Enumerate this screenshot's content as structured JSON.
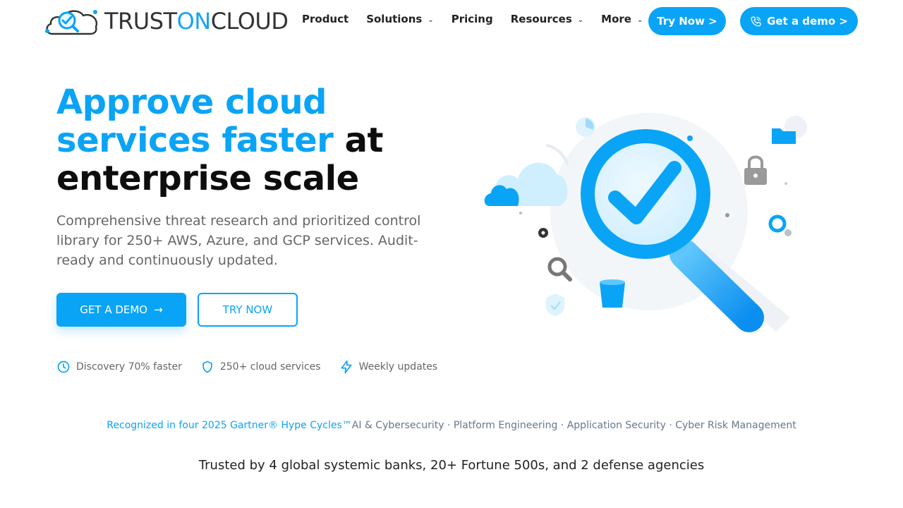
{
  "brand": {
    "name_part1": "TRUST",
    "name_part2": "ON",
    "name_part3": "CLOUD",
    "accent": "#0aa4f6"
  },
  "nav": {
    "items": [
      {
        "label": "Product",
        "has_dropdown": false
      },
      {
        "label": "Solutions",
        "has_dropdown": true
      },
      {
        "label": "Pricing",
        "has_dropdown": false
      },
      {
        "label": "Resources",
        "has_dropdown": true
      },
      {
        "label": "More",
        "has_dropdown": true
      }
    ],
    "try_label": "Try Now >",
    "demo_label": "Get a demo >",
    "demo_icon": "phone-icon"
  },
  "hero": {
    "title_blue": "Approve cloud services faster",
    "title_dark": "at enterprise scale",
    "subtitle": "Comprehensive threat research and prioritized control library for 250+ AWS, Azure, and GCP services. Audit-ready and continuously updated.",
    "cta_primary": "GET A DEMO",
    "cta_primary_icon": "arrow-right-icon",
    "cta_secondary": "TRY NOW",
    "features": [
      {
        "icon": "clock-icon",
        "label": "Discovery 70% faster"
      },
      {
        "icon": "shield-icon",
        "label": "250+ cloud services"
      },
      {
        "icon": "lightning-icon",
        "label": "Weekly updates"
      }
    ]
  },
  "recognition": {
    "highlight": "Recognized in four 2025 Gartner® Hype Cycles™",
    "areas": "AI & Cybersecurity · Platform Engineering · Application Security · Cyber Risk Management"
  },
  "trust_line": "Trusted by 4 global systemic banks, 20+ Fortune 500s, and 2 defense agencies"
}
